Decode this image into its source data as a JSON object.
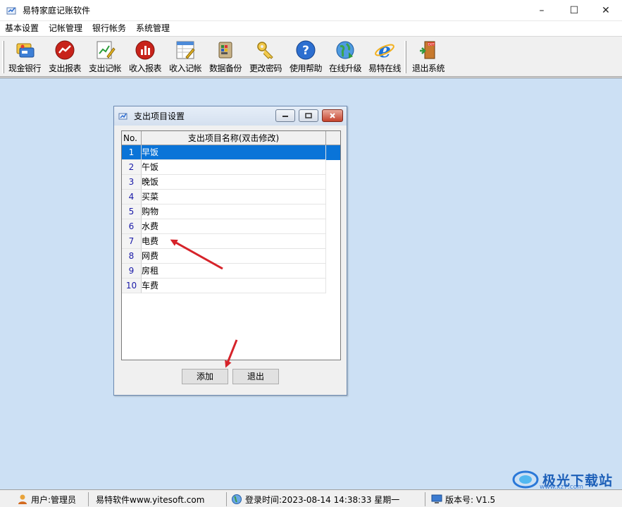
{
  "window": {
    "title": "易特家庭记账软件",
    "controls": {
      "minimize": "–",
      "maximize": "☐",
      "close": "✕"
    }
  },
  "menu": [
    "基本设置",
    "记帐管理",
    "银行帐务",
    "系统管理"
  ],
  "toolbar": [
    {
      "label": "现金银行",
      "icon": "cash-bank-icon"
    },
    {
      "label": "支出报表",
      "icon": "expense-report-icon"
    },
    {
      "label": "支出记帐",
      "icon": "expense-entry-icon"
    },
    {
      "label": "收入报表",
      "icon": "income-report-icon"
    },
    {
      "label": "收入记帐",
      "icon": "income-entry-icon"
    },
    {
      "label": "数据备份",
      "icon": "database-backup-icon"
    },
    {
      "label": "更改密码",
      "icon": "key-icon"
    },
    {
      "label": "使用帮助",
      "icon": "help-icon"
    },
    {
      "label": "在线升级",
      "icon": "globe-update-icon"
    },
    {
      "label": "易特在线",
      "icon": "ie-browser-icon"
    },
    {
      "label": "退出系统",
      "icon": "exit-door-icon"
    }
  ],
  "dialog": {
    "title": "支出项目设置",
    "columns": {
      "no": "No.",
      "name": "支出项目名称(双击修改)"
    },
    "rows": [
      {
        "no": "1",
        "name": "早饭",
        "selected": true
      },
      {
        "no": "2",
        "name": "午饭"
      },
      {
        "no": "3",
        "name": "晚饭"
      },
      {
        "no": "4",
        "name": "买菜"
      },
      {
        "no": "5",
        "name": "购物"
      },
      {
        "no": "6",
        "name": "水费"
      },
      {
        "no": "7",
        "name": "电费"
      },
      {
        "no": "8",
        "name": "网费"
      },
      {
        "no": "9",
        "name": "房租"
      },
      {
        "no": "10",
        "name": "车费"
      }
    ],
    "add_label": "添加",
    "exit_label": "退出"
  },
  "status": {
    "user": "用户:管理员",
    "company": "易特软件www.yitesoft.com",
    "login": "登录时间:2023-08-14 14:38:33 星期一",
    "version": "版本号: V1.5"
  },
  "watermark": {
    "text": "极光下载站",
    "url": "www.xz7.com"
  },
  "colors": {
    "workspace": "#cce0f4",
    "selection": "#0a74d8",
    "annotation_arrow": "#d6232a"
  }
}
